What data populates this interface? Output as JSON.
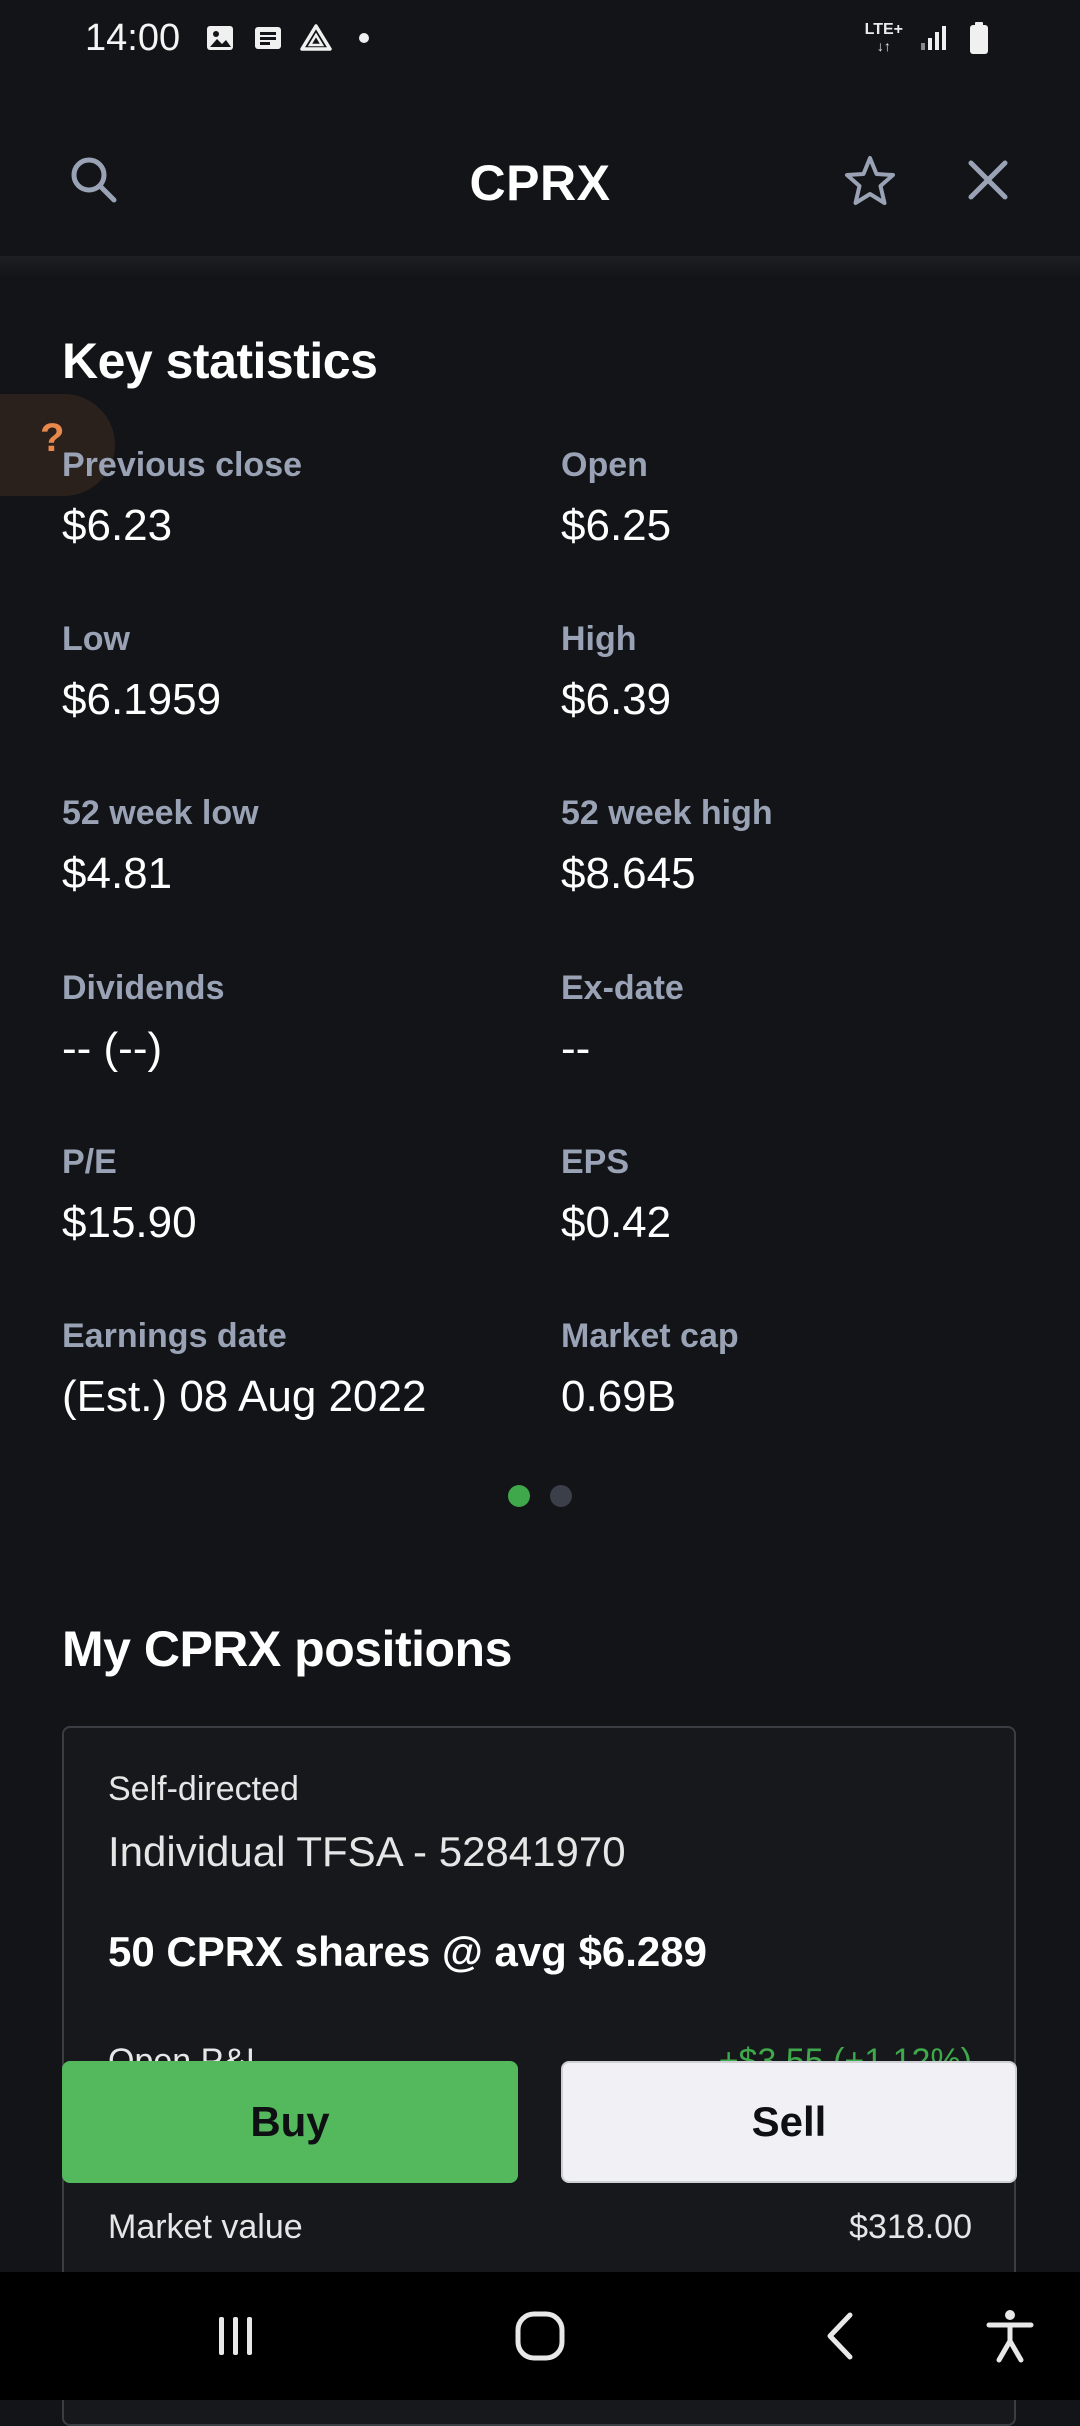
{
  "status_bar": {
    "time": "14:00",
    "notification_icons": [
      "image-icon",
      "news-icon",
      "drive-icon",
      "dot-icon"
    ],
    "network_label": "LTE+",
    "system_icons": [
      "signal-icon",
      "battery-icon"
    ]
  },
  "header": {
    "title": "CPRX",
    "icons": [
      "search-icon",
      "star-icon",
      "close-icon"
    ]
  },
  "help_tab": {
    "label": "?"
  },
  "key_statistics": {
    "title": "Key statistics",
    "items": [
      {
        "label": "Previous close",
        "value": "$6.23"
      },
      {
        "label": "Open",
        "value": "$6.25"
      },
      {
        "label": "Low",
        "value": "$6.1959"
      },
      {
        "label": "High",
        "value": "$6.39"
      },
      {
        "label": "52 week low",
        "value": "$4.81"
      },
      {
        "label": "52 week high",
        "value": "$8.645"
      },
      {
        "label": "Dividends",
        "value": "-- (--)"
      },
      {
        "label": "Ex-date",
        "value": "--"
      },
      {
        "label": "P/E",
        "value": "$15.90"
      },
      {
        "label": "EPS",
        "value": "$0.42"
      },
      {
        "label": "Earnings date",
        "value": "(Est.) 08 Aug 2022"
      },
      {
        "label": "Market cap",
        "value": "0.69B"
      }
    ],
    "pager": {
      "pages": 2,
      "active_page": 1
    }
  },
  "positions": {
    "title": "My CPRX positions",
    "card": {
      "type": "Self-directed",
      "account": "Individual TFSA - 52841970",
      "shares": "50 CPRX shares @ avg $6.289",
      "open_pnl_label": "Open P&L",
      "open_pnl_value": "+$3.55 (+1.12%)",
      "market_value_label": "Market value",
      "market_value": "$318.00"
    }
  },
  "actions": {
    "buy_label": "Buy",
    "sell_label": "Sell"
  },
  "nav_bar": {
    "icons": [
      "recent-apps-icon",
      "home-icon",
      "back-icon",
      "accessibility-icon"
    ]
  },
  "colors": {
    "background": "#131417",
    "label_gray": "#9aa3b6",
    "positive_green": "#3ea84a",
    "buy_button": "#54b95c",
    "sell_button": "#f1f1f5",
    "help_accent": "#e8884a"
  }
}
